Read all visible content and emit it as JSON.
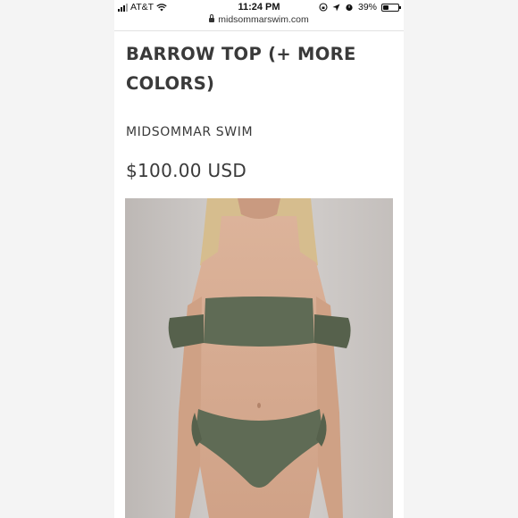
{
  "status_bar": {
    "carrier": "AT&T",
    "time": "11:24 PM",
    "battery_percent": "39%",
    "battery_level": 0.39
  },
  "browser": {
    "url": "midsommarswim.com"
  },
  "product": {
    "title_line1": "BARROW TOP (+ MORE",
    "title_line2": "COLORS)",
    "brand": "MIDSOMMAR SWIM",
    "price": "$100.00 USD"
  },
  "colors": {
    "swimsuit": "#5f6b55",
    "background": "#cfcbc8",
    "text": "#3a3a3a"
  },
  "icons": [
    "wifi-icon",
    "signal-icon",
    "lock-icon",
    "location-icon",
    "alarm-icon",
    "battery-icon"
  ]
}
